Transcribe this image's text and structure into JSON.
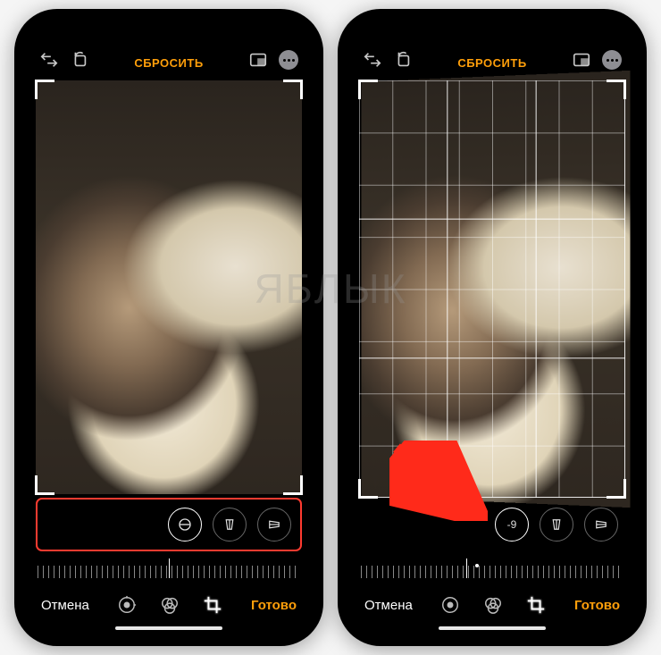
{
  "watermark": "ЯБЛЫК",
  "left": {
    "topbar": {
      "reset": "СБРОСИТЬ"
    },
    "tools": {
      "straighten_icon": "straighten-icon",
      "flip_icon": "flip-horizontal-icon",
      "perspective_icon": "perspective-icon"
    },
    "bottombar": {
      "cancel": "Отмена",
      "done": "Готово"
    }
  },
  "right": {
    "topbar": {
      "reset": "СБРОСИТЬ"
    },
    "tools": {
      "straighten_value": "-9",
      "flip_icon": "flip-horizontal-icon",
      "perspective_icon": "perspective-icon"
    },
    "bottombar": {
      "cancel": "Отмена",
      "done": "Готово"
    }
  }
}
